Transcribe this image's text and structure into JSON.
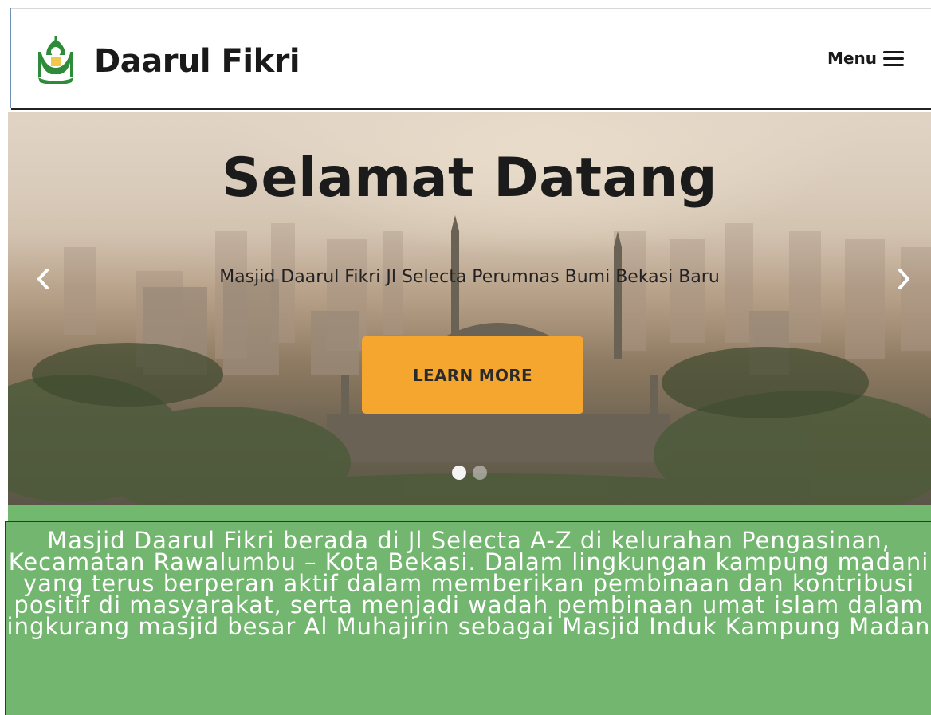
{
  "header": {
    "brand_name": "Daarul Fikri",
    "menu_label": "Menu",
    "logo_icon": "mosque-logo-icon",
    "menu_icon": "hamburger-icon"
  },
  "hero": {
    "title": "Selamat Datang",
    "subtitle": "Masjid Daarul Fikri Jl Selecta Perumnas Bumi Bekasi Baru",
    "cta_label": "LEARN MORE",
    "slide_count": 2,
    "active_slide": 1,
    "prev_icon": "chevron-left-icon",
    "next_icon": "chevron-right-icon"
  },
  "about": {
    "text": "Masjid Daarul Fikri berada di Jl Selecta A-Z di kelurahan Pengasinan, Kecamatan Rawalumbu – Kota Bekasi. Dalam lingkungan kampung madani yang terus berperan aktif dalam memberikan pembinaan dan kontribusi positif di masyarakat, serta menjadi wadah pembinaan umat islam dalam lingkurang masjid besar Al Muhajirin sebagai Masjid Induk Kampung Madani"
  },
  "colors": {
    "accent": "#f5a62e",
    "section_green": "#73b66f",
    "logo_green": "#2e8b3a"
  }
}
